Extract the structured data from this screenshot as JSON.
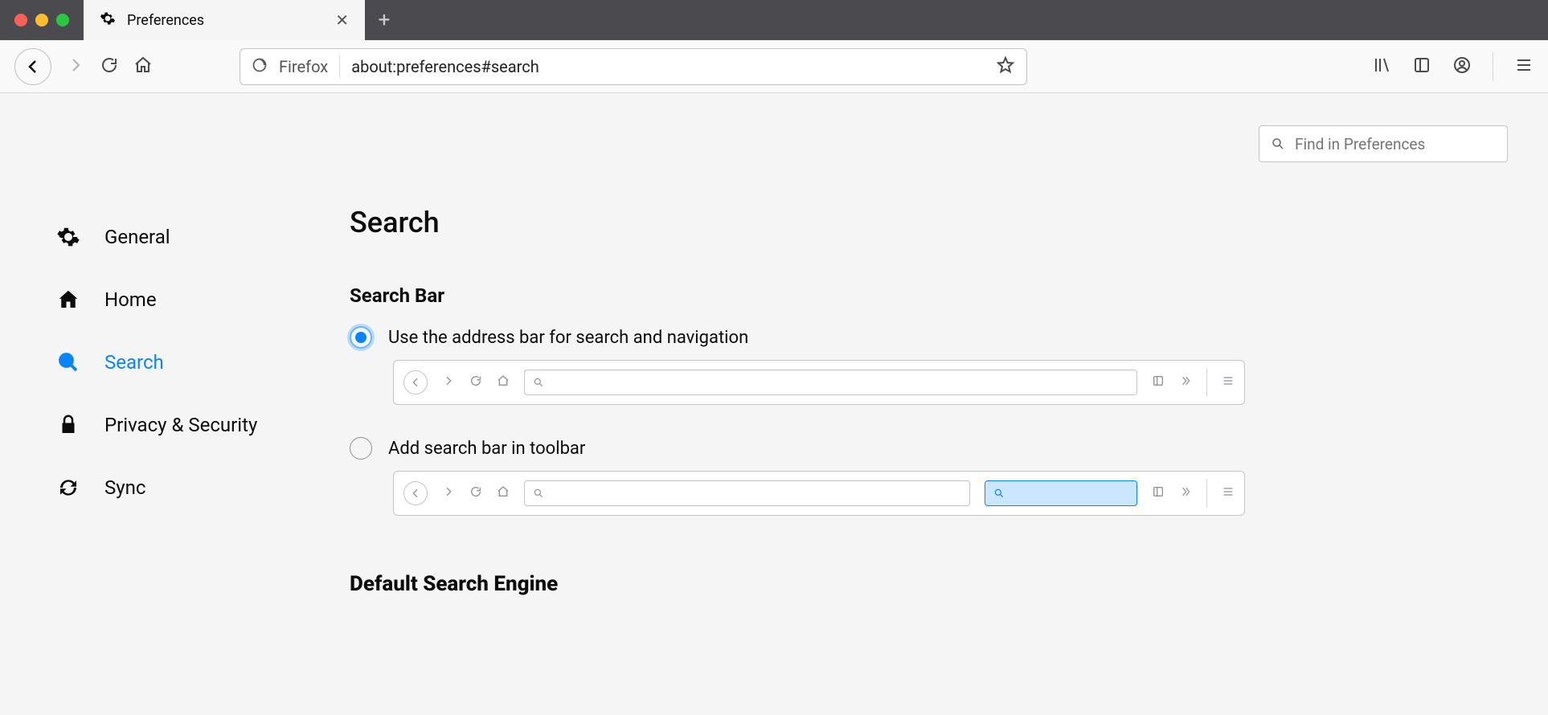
{
  "window": {
    "tab_title": "Preferences",
    "url_label": "Firefox",
    "url": "about:preferences#search"
  },
  "find": {
    "placeholder": "Find in Preferences"
  },
  "sidebar": {
    "items": [
      {
        "id": "general",
        "label": "General"
      },
      {
        "id": "home",
        "label": "Home"
      },
      {
        "id": "search",
        "label": "Search"
      },
      {
        "id": "privacy",
        "label": "Privacy & Security"
      },
      {
        "id": "sync",
        "label": "Sync"
      }
    ],
    "active": "search"
  },
  "main": {
    "title": "Search",
    "section_searchbar": {
      "heading": "Search Bar",
      "option_unified": "Use the address bar for search and navigation",
      "option_separate": "Add search bar in toolbar",
      "selected": "unified"
    },
    "section_default_engine_heading": "Default Search Engine"
  }
}
